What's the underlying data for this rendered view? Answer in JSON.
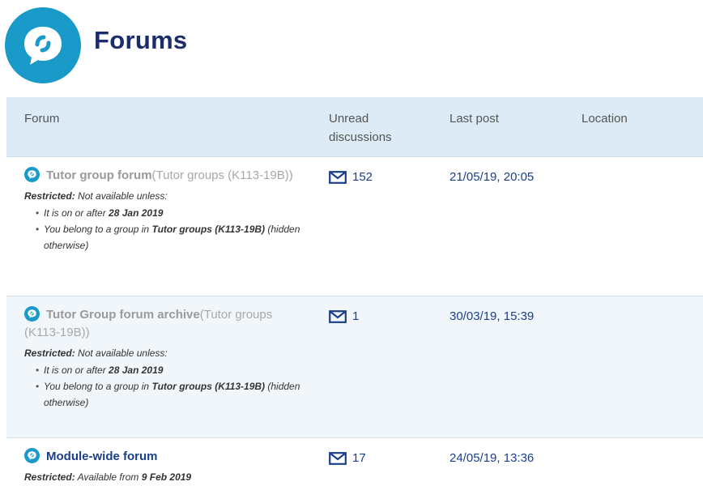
{
  "page": {
    "title": "Forums"
  },
  "colors": {
    "brand": "#1a9ac8",
    "title": "#1c2d6b",
    "link": "#1c3f8a",
    "header_bg": "#dcebf5"
  },
  "table": {
    "headers": {
      "forum": "Forum",
      "unread": "Unread discussions",
      "last_post": "Last post",
      "location": "Location"
    },
    "rows": [
      {
        "name": "Tutor group forum",
        "group": "(Tutor groups (K113-19B))",
        "restricted_label": "Restricted:",
        "restricted_text": " Not available unless:",
        "cond1_pre": "It is on or after ",
        "cond1_bold": "28 Jan 2019",
        "cond2_pre": "You belong to a group in ",
        "cond2_bold": "Tutor groups (K113-19B)",
        "cond2_post": " (hidden otherwise)",
        "unread": "152",
        "last_post": "21/05/19, 20:05"
      },
      {
        "name": "Tutor Group forum archive",
        "group": "(Tutor groups (K113-19B))",
        "restricted_label": "Restricted:",
        "restricted_text": " Not available unless:",
        "cond1_pre": "It is on or after ",
        "cond1_bold": "28 Jan 2019",
        "cond2_pre": "You belong to a group in ",
        "cond2_bold": "Tutor groups (K113-19B)",
        "cond2_post": " (hidden otherwise)",
        "unread": "1",
        "last_post": "30/03/19, 15:39"
      },
      {
        "name": "Module-wide forum",
        "restricted_label": "Restricted:",
        "restricted_text": " Available from ",
        "restricted_bold": "9 Feb 2019",
        "unread": "17",
        "last_post": "24/05/19, 13:36"
      }
    ]
  },
  "icons": {
    "logo": "forum-speech-bubble-icon",
    "row": "forum-icon",
    "unread": "envelope-icon"
  }
}
